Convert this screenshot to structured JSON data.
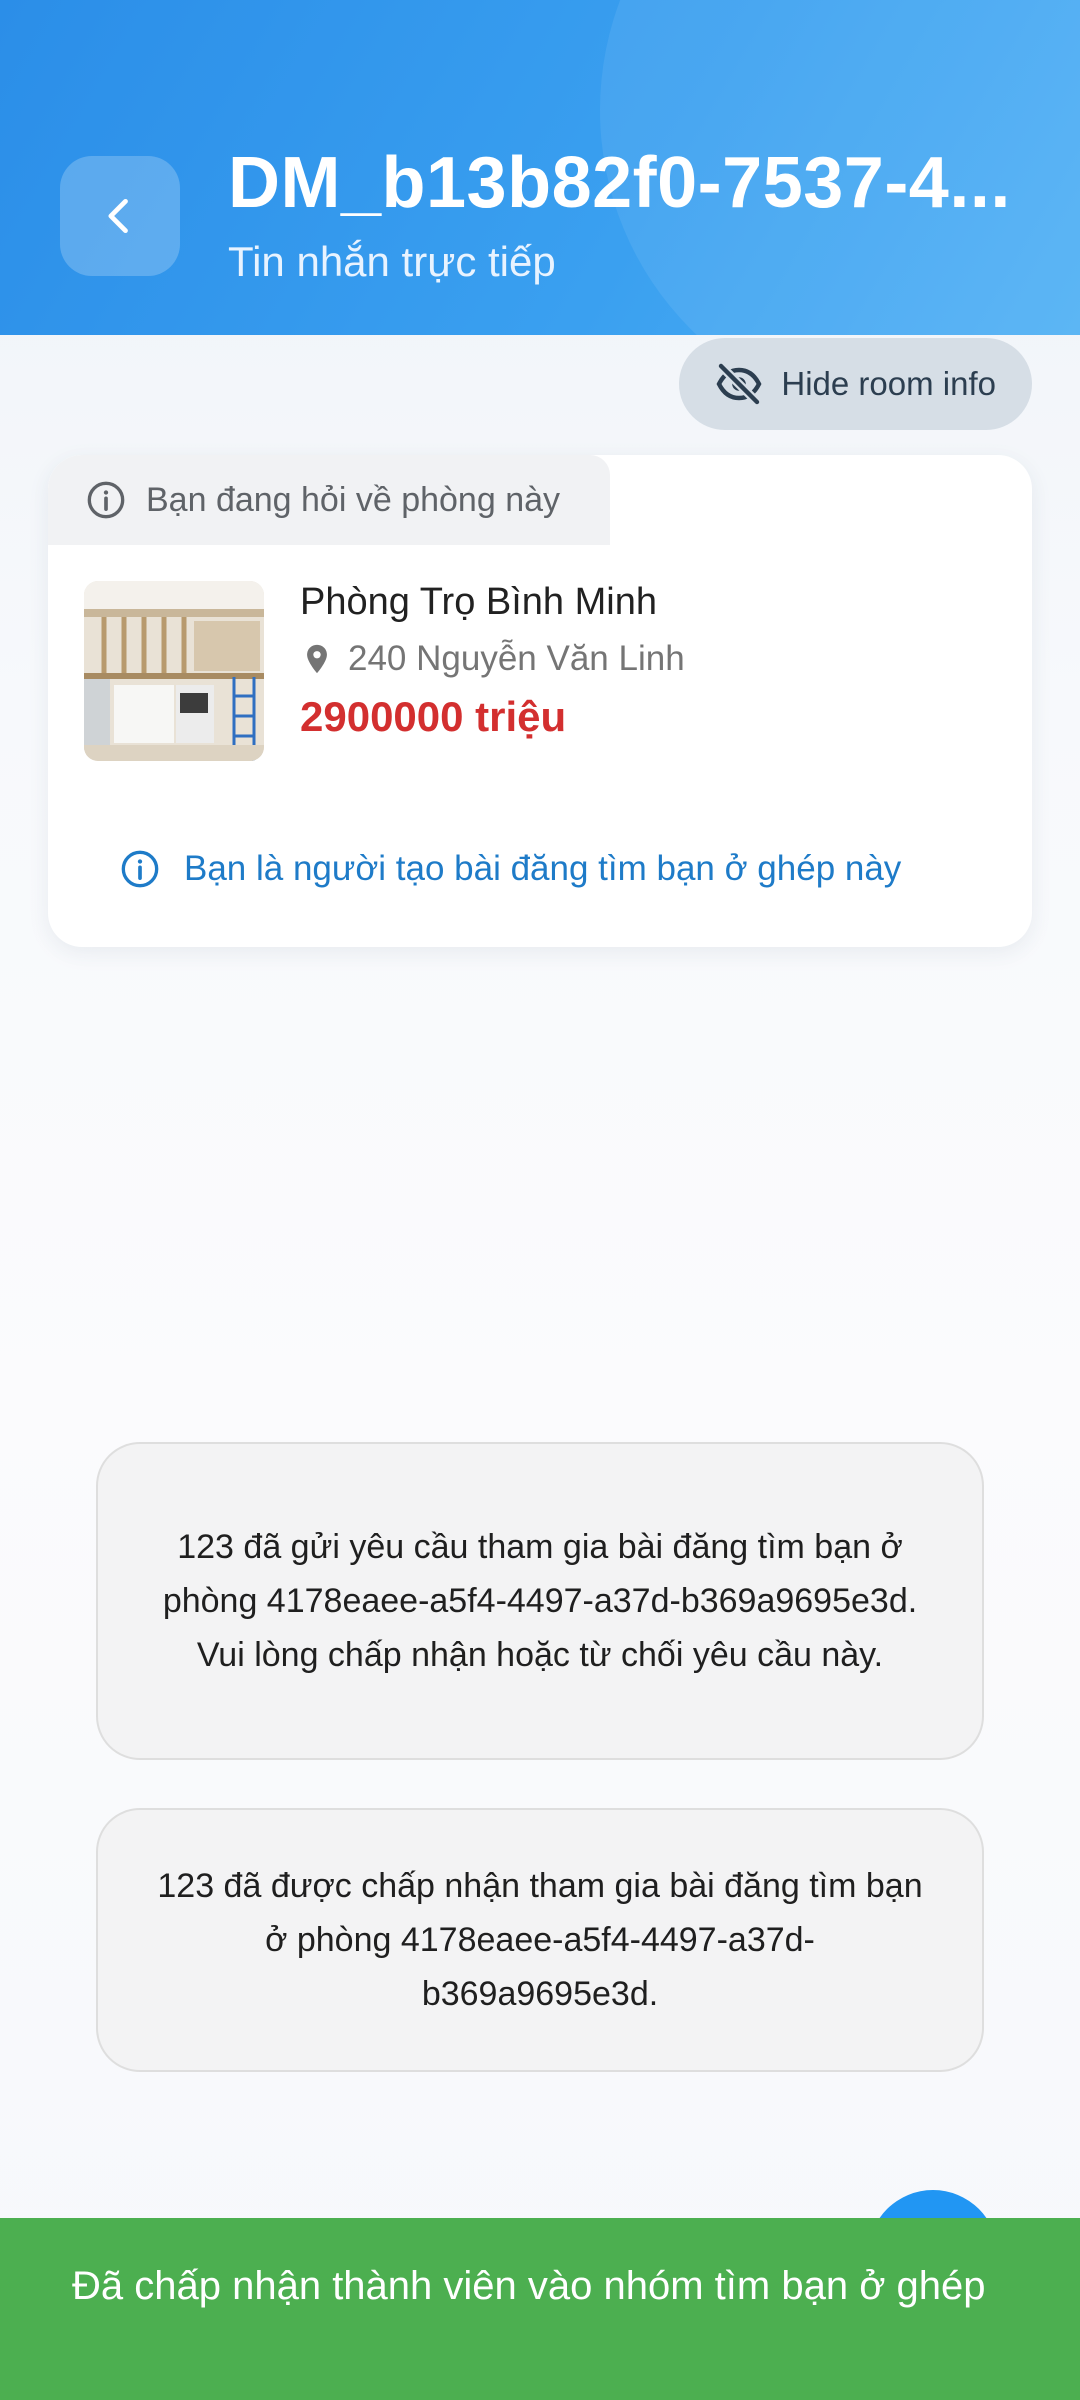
{
  "header": {
    "title": "DM_b13b82f0-7537-4...",
    "subtitle": "Tin nhắn trực tiếp"
  },
  "hide_button": {
    "label": "Hide room info"
  },
  "room_card": {
    "tab_label": "Bạn đang hỏi về phòng này",
    "name": "Phòng Trọ Bình Minh",
    "address": "240 Nguyễn Văn Linh",
    "price": "2900000 triệu",
    "owner_note": "Bạn là người tạo bài đăng tìm bạn ở ghép này"
  },
  "messages": [
    {
      "text": "123 đã gửi yêu cầu tham gia bài đăng tìm bạn ở phòng 4178eaee-a5f4-4497-a37d-b369a9695e3d. Vui lòng chấp nhận hoặc từ chối yêu cầu này."
    },
    {
      "text": "123 đã được chấp nhận tham gia bài đăng tìm bạn ở phòng 4178eaee-a5f4-4497-a37d-b369a9695e3d."
    }
  ],
  "snackbar": {
    "text": "Đã chấp nhận thành viên vào nhóm tìm bạn ở ghép"
  },
  "colors": {
    "header": "#2b8ee8",
    "price": "#d32f2f",
    "note": "#1e7bc8",
    "snackbar": "#4caf50"
  },
  "icons": {
    "back": "chevron-left-icon",
    "hide": "eye-off-icon",
    "info": "info-icon",
    "location": "location-pin-icon"
  }
}
